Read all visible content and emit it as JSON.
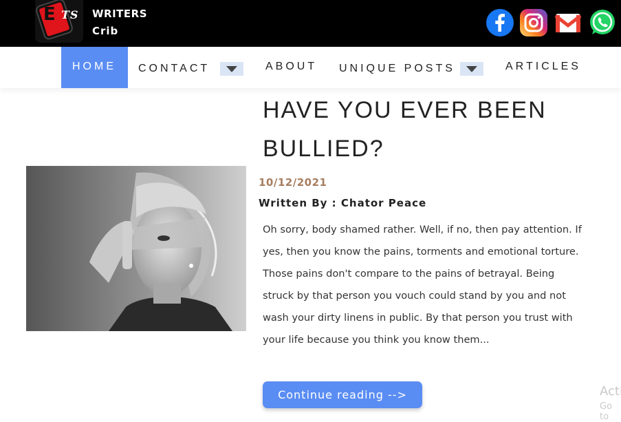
{
  "header": {
    "logo": {
      "letter": "E",
      "suffix": "TS"
    },
    "brand_line1": "WRITERS",
    "brand_line2": "Crib",
    "social": [
      "facebook-icon",
      "instagram-icon",
      "gmail-icon",
      "whatsapp-icon"
    ]
  },
  "nav": {
    "home": "HOME",
    "contact": "CONTACT",
    "about": "ABOUT",
    "unique_posts": "UNIQUE POSTS",
    "articles": "ARTICLES",
    "active": "home"
  },
  "post": {
    "title": "HAVE YOU EVER BEEN BULLIED?",
    "date": "10/12/2021",
    "author": "Written By : Chator Peace",
    "excerpt": "Oh sorry, body shamed rather. Well, if no, then pay attention. If yes, then you know the pains, torments and emotional torture. Those pains don't compare to the pains of betrayal. Being struck by that person you vouch could stand by you and not wash your dirty linens in public. By that person you trust with your life because you think you know them...",
    "read_more": "Continue reading -->"
  },
  "watermark": {
    "line1": "Acti",
    "line2": "Go to"
  },
  "colors": {
    "accent": "#5a8df3",
    "date": "#a77e5f",
    "header_bg": "#000000",
    "dropdown_bg": "#d9e5f5"
  }
}
